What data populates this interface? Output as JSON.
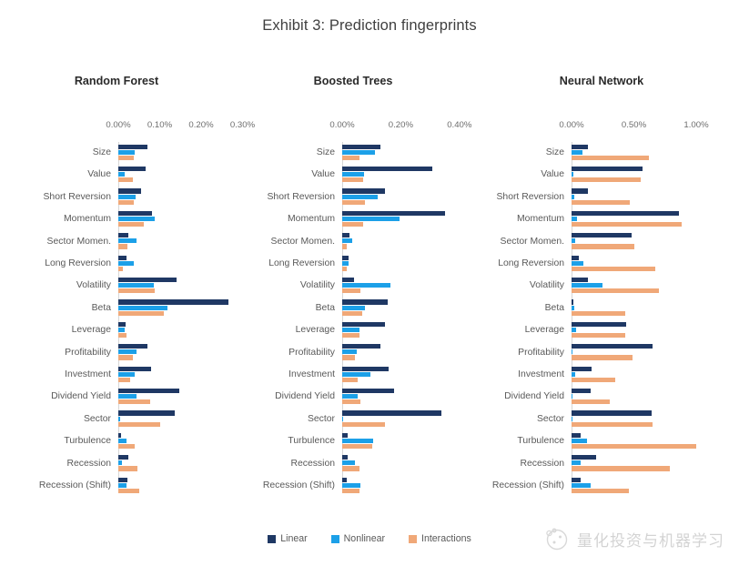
{
  "title": "Exhibit 3: Prediction fingerprints",
  "legend": {
    "position": "bottom-center",
    "items": [
      {
        "label": "Linear",
        "color": "#1F3864"
      },
      {
        "label": "Nonlinear",
        "color": "#1CA0E8"
      },
      {
        "label": "Interactions",
        "color": "#F0A878"
      }
    ]
  },
  "watermark": {
    "text": "量化投资与机器学习"
  },
  "chart_data": [
    {
      "type": "bar",
      "orientation": "horizontal",
      "title": "Random Forest",
      "xlabel": "",
      "ylabel": "",
      "xlim": [
        0,
        0.3246
      ],
      "grid": false,
      "tick_labels": [
        "0.00%",
        "0.10%",
        "0.20%",
        "0.30%"
      ],
      "tick_values": [
        0,
        0.1,
        0.2,
        0.3
      ],
      "categories": [
        "Size",
        "Value",
        "Short Reversion",
        "Momentum",
        "Sector Momen.",
        "Long Reversion",
        "Volatility",
        "Beta",
        "Leverage",
        "Profitability",
        "Investment",
        "Dividend Yield",
        "Sector",
        "Turbulence",
        "Recession",
        "Recession (Shift)"
      ],
      "series": [
        {
          "name": "Linear",
          "color": "#1F3864",
          "values": [
            0.07,
            0.066,
            0.054,
            0.082,
            0.024,
            0.02,
            0.141,
            0.265,
            0.017,
            0.071,
            0.08,
            0.147,
            0.136,
            0.007,
            0.024,
            0.022
          ]
        },
        {
          "name": "Nonlinear",
          "color": "#1CA0E8",
          "values": [
            0.04,
            0.015,
            0.041,
            0.089,
            0.043,
            0.037,
            0.085,
            0.118,
            0.015,
            0.043,
            0.04,
            0.044,
            0.004,
            0.02,
            0.009,
            0.02
          ]
        },
        {
          "name": "Interactions",
          "color": "#F0A878",
          "values": [
            0.037,
            0.036,
            0.037,
            0.061,
            0.022,
            0.01,
            0.088,
            0.11,
            0.019,
            0.035,
            0.029,
            0.076,
            0.1,
            0.04,
            0.047,
            0.05
          ]
        }
      ]
    },
    {
      "type": "bar",
      "orientation": "horizontal",
      "title": "Boosted Trees",
      "xlabel": "",
      "ylabel": "",
      "xlim": [
        0,
        0.436
      ],
      "grid": false,
      "tick_labels": [
        "0.00%",
        "0.20%",
        "0.40%"
      ],
      "tick_values": [
        0,
        0.2,
        0.4
      ],
      "categories": [
        "Size",
        "Value",
        "Short Reversion",
        "Momentum",
        "Sector Momen.",
        "Long Reversion",
        "Volatility",
        "Beta",
        "Leverage",
        "Profitability",
        "Investment",
        "Dividend Yield",
        "Sector",
        "Turbulence",
        "Recession",
        "Recession (Shift)"
      ],
      "series": [
        {
          "name": "Linear",
          "color": "#1F3864",
          "values": [
            0.131,
            0.309,
            0.147,
            0.35,
            0.026,
            0.023,
            0.039,
            0.156,
            0.146,
            0.129,
            0.158,
            0.178,
            0.34,
            0.018,
            0.018,
            0.015
          ]
        },
        {
          "name": "Nonlinear",
          "color": "#1CA0E8",
          "values": [
            0.112,
            0.075,
            0.12,
            0.196,
            0.033,
            0.021,
            0.165,
            0.078,
            0.059,
            0.051,
            0.095,
            0.052,
            0.004,
            0.107,
            0.044,
            0.062
          ]
        },
        {
          "name": "Interactions",
          "color": "#F0A878",
          "values": [
            0.058,
            0.072,
            0.079,
            0.07,
            0.017,
            0.014,
            0.063,
            0.067,
            0.058,
            0.044,
            0.053,
            0.063,
            0.145,
            0.104,
            0.058,
            0.058
          ]
        }
      ]
    },
    {
      "type": "bar",
      "orientation": "horizontal",
      "title": "Neural Network",
      "xlabel": "",
      "ylabel": "",
      "xlim": [
        0,
        1.1
      ],
      "grid": false,
      "tick_labels": [
        "0.00%",
        "0.50%",
        "1.00%"
      ],
      "tick_values": [
        0,
        0.5,
        1.0
      ],
      "categories": [
        "Size",
        "Value",
        "Short Reversion",
        "Momentum",
        "Sector Momen.",
        "Long Reversion",
        "Volatility",
        "Beta",
        "Leverage",
        "Profitability",
        "Investment",
        "Dividend Yield",
        "Sector",
        "Turbulence",
        "Recession",
        "Recession (Shift)"
      ],
      "series": [
        {
          "name": "Linear",
          "color": "#1F3864",
          "values": [
            0.13,
            0.57,
            0.135,
            0.86,
            0.48,
            0.06,
            0.135,
            0.015,
            0.44,
            0.65,
            0.16,
            0.155,
            0.64,
            0.075,
            0.2,
            0.075
          ]
        },
        {
          "name": "Nonlinear",
          "color": "#1CA0E8",
          "values": [
            0.085,
            0.012,
            0.02,
            0.045,
            0.03,
            0.095,
            0.25,
            0.02,
            0.035,
            0.008,
            0.03,
            0.006,
            0.005,
            0.125,
            0.07,
            0.155
          ]
        },
        {
          "name": "Interactions",
          "color": "#F0A878",
          "values": [
            0.62,
            0.555,
            0.465,
            0.88,
            0.5,
            0.67,
            0.7,
            0.43,
            0.43,
            0.49,
            0.35,
            0.305,
            0.65,
            1.0,
            0.79,
            0.46
          ]
        }
      ]
    }
  ]
}
